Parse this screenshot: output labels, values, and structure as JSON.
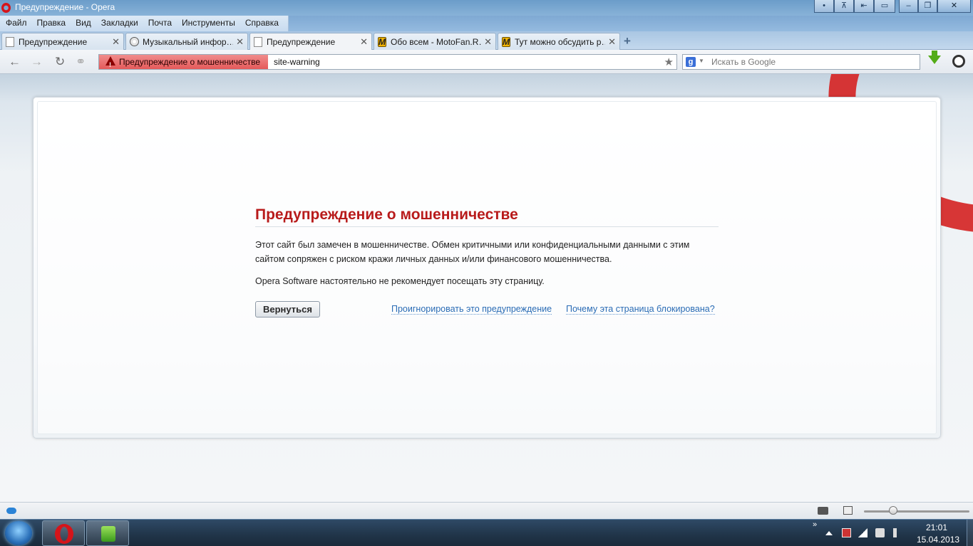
{
  "window": {
    "title": "Предупреждение - Opera",
    "controls": [
      "•",
      "⊼",
      "⇤",
      "▭",
      "–",
      "❐",
      "✕"
    ]
  },
  "menu": {
    "items": [
      "Файл",
      "Правка",
      "Вид",
      "Закладки",
      "Почта",
      "Инструменты",
      "Справка"
    ]
  },
  "tabs": [
    {
      "label": "Предупреждение",
      "icon": "page-icon",
      "active": false
    },
    {
      "label": "Музыкальный инфор…",
      "icon": "disc-icon",
      "active": false
    },
    {
      "label": "Предупреждение",
      "icon": "page-icon",
      "active": true
    },
    {
      "label": "Обо всем - MotoFan.R…",
      "icon": "motofan-icon",
      "active": false
    },
    {
      "label": "Тут можно обсудить р…",
      "icon": "motofan-icon",
      "active": false
    }
  ],
  "tab_close": "✕",
  "new_tab": "+",
  "address": {
    "badge": "Предупреждение о мошенничестве",
    "url": "site-warning",
    "search_placeholder": "Искать в Google",
    "search_engine_glyph": "g"
  },
  "page": {
    "title": "Предупреждение о мошенничестве",
    "paragraph1": "Этот сайт был замечен в мошенничестве. Обмен критичными или конфиденциальными данными с этим сайтом сопряжен с риском кражи личных данных и/или финансового мошенничества.",
    "paragraph2": "Opera Software настоятельно не рекомендует посещать эту страницу.",
    "back_button": "Вернуться",
    "ignore_link": "Проигнорировать это предупреждение",
    "why_link": "Почему эта страница блокирована?"
  },
  "taskbar": {
    "time": "21:01",
    "date": "15.04.2013",
    "tray_chevron": "»"
  },
  "colors": {
    "warning_red": "#b81b1b",
    "badge_red": "#e55a5a",
    "link_blue": "#2a6cb5",
    "opera_red": "#d5141a"
  }
}
